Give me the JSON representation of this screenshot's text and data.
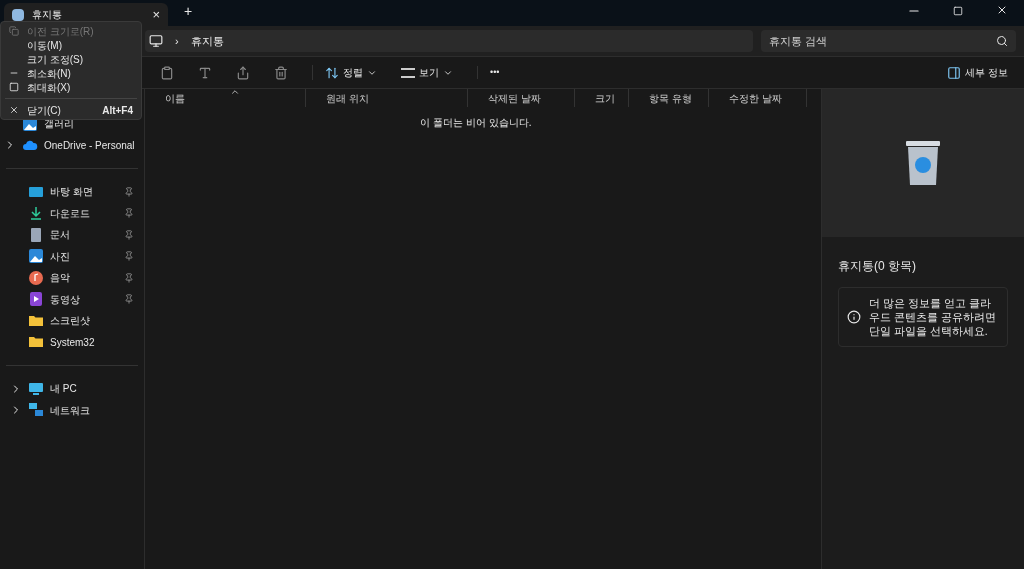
{
  "tab": {
    "title": "휴지통",
    "close": "×",
    "new": "+"
  },
  "address": {
    "crumb": "휴지통",
    "separator": "›"
  },
  "search": {
    "placeholder": "휴지통 검색"
  },
  "toolbar": {
    "sort": "정렬",
    "view": "보기",
    "more": "•••",
    "details": "세부 정보"
  },
  "system_menu": [
    {
      "label": "이전 크기로(R)",
      "kind": "restore",
      "disabled": true
    },
    {
      "label": "이동(M)",
      "kind": "plain",
      "disabled": false
    },
    {
      "label": "크기 조정(S)",
      "kind": "plain",
      "disabled": false
    },
    {
      "label": "최소화(N)",
      "kind": "minimize",
      "disabled": false
    },
    {
      "label": "최대화(X)",
      "kind": "maximize",
      "disabled": false
    },
    {
      "label": "닫기(C)",
      "kind": "close",
      "disabled": false,
      "shortcut": "Alt+F4"
    }
  ],
  "sidebar": [
    [
      {
        "label": "갤러리",
        "kind": "gallery",
        "expandable": false,
        "pinned": false
      },
      {
        "label": "OneDrive - Personal",
        "kind": "cloud",
        "expandable": true,
        "pinned": false
      }
    ],
    [
      {
        "label": "바탕 화면",
        "kind": "desktop",
        "expandable": false,
        "pinned": true
      },
      {
        "label": "다운로드",
        "kind": "download",
        "expandable": false,
        "pinned": true
      },
      {
        "label": "문서",
        "kind": "document",
        "expandable": false,
        "pinned": true
      },
      {
        "label": "사진",
        "kind": "gallery",
        "expandable": false,
        "pinned": true
      },
      {
        "label": "음악",
        "kind": "music",
        "expandable": false,
        "pinned": true
      },
      {
        "label": "동영상",
        "kind": "video",
        "expandable": false,
        "pinned": true
      },
      {
        "label": "스크린샷",
        "kind": "folder",
        "expandable": false,
        "pinned": false
      },
      {
        "label": "System32",
        "kind": "folder",
        "expandable": false,
        "pinned": false
      }
    ],
    [
      {
        "label": "내 PC",
        "kind": "monitor",
        "expandable": true,
        "pinned": false
      },
      {
        "label": "네트워크",
        "kind": "network",
        "expandable": true,
        "pinned": false
      }
    ]
  ],
  "columns": [
    "이름",
    "원래 위치",
    "삭제된 날짜",
    "크기",
    "항목 유형",
    "수정한 날짜"
  ],
  "empty_message": "이 폴더는 비어 있습니다.",
  "details": {
    "title": "휴지통(0 항목)",
    "info": "더 많은 정보를 얻고 클라우드 콘텐츠를 공유하려면 단일 파일을 선택하세요."
  }
}
